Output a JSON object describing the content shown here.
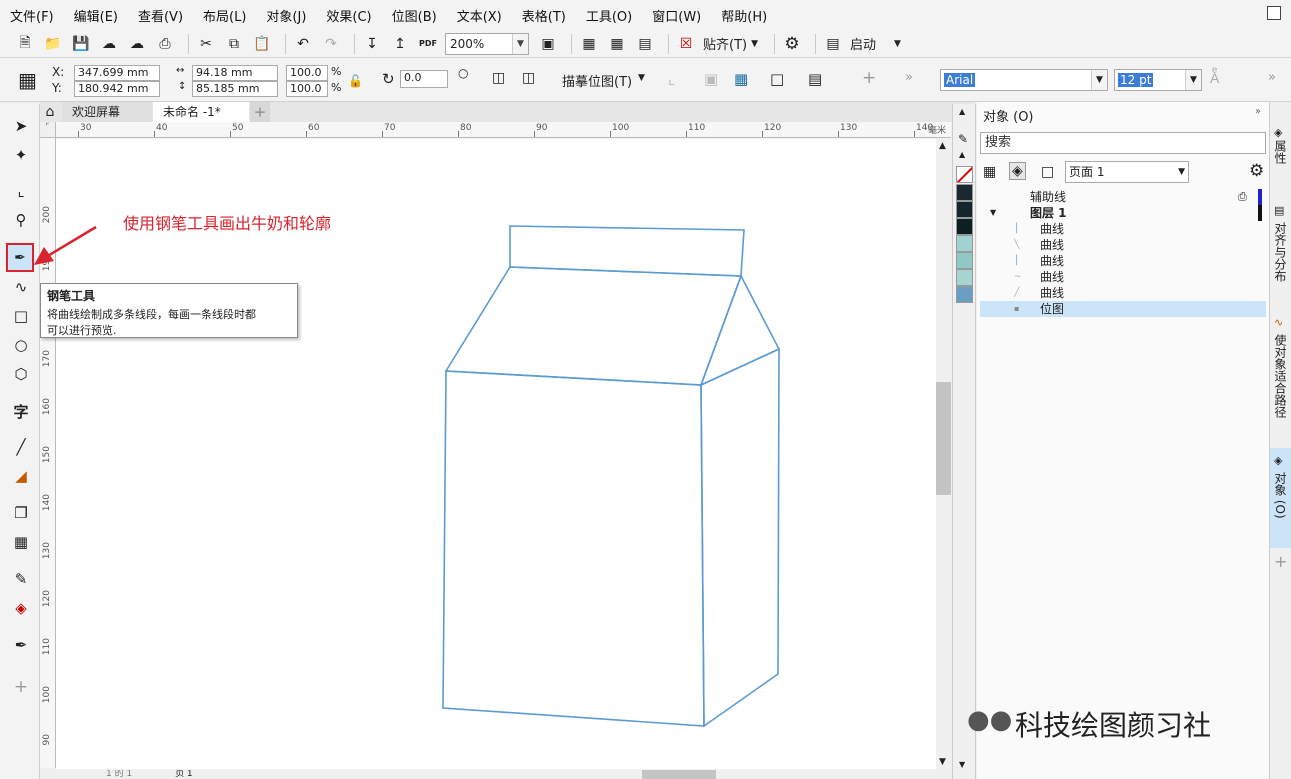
{
  "menu": [
    "文件(F)",
    "编辑(E)",
    "查看(V)",
    "布局(L)",
    "对象(J)",
    "效果(C)",
    "位图(B)",
    "文本(X)",
    "表格(T)",
    "工具(O)",
    "窗口(W)",
    "帮助(H)"
  ],
  "toolbar": {
    "zoom": "200%",
    "snap": "贴齐(T)",
    "launch": "启动",
    "pdf": "PDF"
  },
  "propbar": {
    "x_label": "X:",
    "y_label": "Y:",
    "x": "347.699 mm",
    "y": "180.942 mm",
    "w": "94.18 mm",
    "h": "85.185 mm",
    "sx": "100.0",
    "sy": "100.0",
    "pct": "%",
    "rotation": "0.0",
    "trace": "描摹位图(T)",
    "font": "Arial",
    "size": "12 pt"
  },
  "tabs": [
    "欢迎屏幕",
    "未命名 -1*"
  ],
  "hruler": [
    "30",
    "40",
    "50",
    "60",
    "70",
    "80",
    "90",
    "100",
    "110",
    "120",
    "130",
    "140"
  ],
  "hruler_unit": "毫米",
  "vruler": [
    "200",
    "190",
    "180",
    "170",
    "160",
    "150",
    "140",
    "130",
    "120",
    "110",
    "100",
    "90",
    "80"
  ],
  "annotation": "使用钢笔工具画出牛奶和轮廓",
  "tooltip": {
    "title": "钢笔工具",
    "desc1": "将曲线绘制成多条线段，每画一条线段时都",
    "desc2": "可以进行预览."
  },
  "docker": {
    "title": "对象 (O)",
    "search": "搜索",
    "page": "页面 1",
    "items": [
      "辅助线",
      "图层 1",
      "曲线",
      "曲线",
      "曲线",
      "曲线",
      "曲线",
      "位图"
    ]
  },
  "side_tabs": [
    "属性",
    "对齐与分布",
    "使对象适合路径",
    "对象 (O)"
  ],
  "watermark": "科技绘图颜习社",
  "status": {
    "page_tab": "页 1",
    "page_nav": "1 的 1"
  },
  "colors": {
    "accent": "#d9232d",
    "outline": "#5b9bd5",
    "selection": "#cce4f7"
  }
}
